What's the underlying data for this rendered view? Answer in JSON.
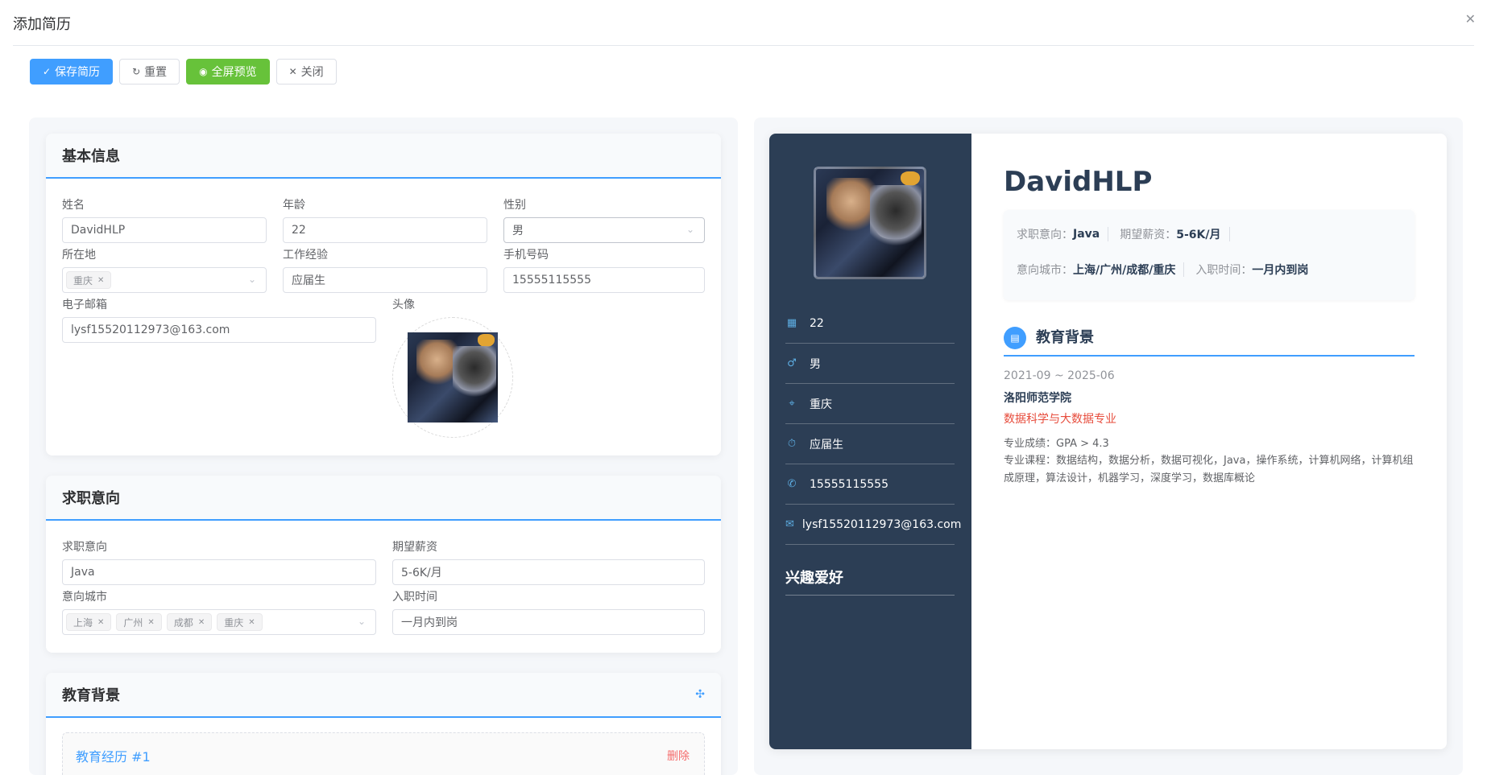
{
  "dialog": {
    "title": "添加简历",
    "close_icon": "close-icon"
  },
  "toolbar": {
    "save": "保存简历",
    "reset": "重置",
    "preview": "全屏预览",
    "close": "关闭"
  },
  "basic": {
    "title": "基本信息",
    "name_label": "姓名",
    "name_value": "DavidHLP",
    "age_label": "年龄",
    "age_value": "22",
    "gender_label": "性别",
    "gender_value": "男",
    "location_label": "所在地",
    "location_tags": [
      "重庆"
    ],
    "experience_label": "工作经验",
    "experience_value": "应届生",
    "phone_label": "手机号码",
    "phone_value": "15555115555",
    "email_label": "电子邮箱",
    "email_value": "lysf15520112973@163.com",
    "avatar_label": "头像"
  },
  "intent": {
    "title": "求职意向",
    "job_label": "求职意向",
    "job_value": "Java",
    "salary_label": "期望薪资",
    "salary_value": "5-6K/月",
    "city_label": "意向城市",
    "city_tags": [
      "上海",
      "广州",
      "成都",
      "重庆"
    ],
    "entry_label": "入职时间",
    "entry_value": "一月内到岗"
  },
  "education_form": {
    "title": "教育背景",
    "item_title": "教育经历 #1",
    "delete": "删除"
  },
  "resume": {
    "name": "DavidHLP",
    "side": {
      "age": "22",
      "gender": "男",
      "location": "重庆",
      "experience": "应届生",
      "phone": "15555115555",
      "email": "lysf15520112973@163.com",
      "hobby_title": "兴趣爱好"
    },
    "intent": {
      "job_key": "求职意向：",
      "job_val": "Java",
      "salary_key": "期望薪资：",
      "salary_val": "5-6K/月",
      "city_key": "意向城市：",
      "city_val": "上海/广州/成都/重庆",
      "entry_key": "入职时间：",
      "entry_val": "一月内到岗"
    },
    "education": {
      "title": "教育背景",
      "date": "2021-09 ~ 2025-06",
      "school": "洛阳师范学院",
      "major": "数据科学与大数据专业",
      "gpa": "专业成绩：GPA > 4.3",
      "courses": "专业课程：数据结构，数据分析，数据可视化，Java，操作系统，计算机网络，计算机组成原理，算法设计，机器学习，深度学习，数据库概论"
    }
  },
  "colors": {
    "primary": "#409eff",
    "success": "#67c23a",
    "danger": "#f56c6c",
    "sidebar": "#2c3e55",
    "major_red": "#e74c3c"
  }
}
